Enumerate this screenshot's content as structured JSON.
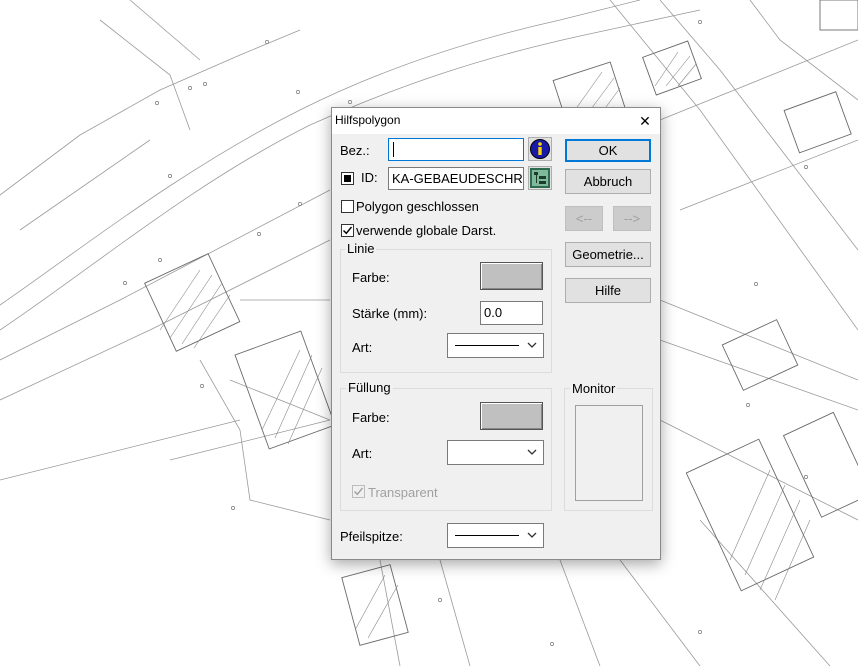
{
  "dialog": {
    "title": "Hilfspolygon",
    "close_glyph": "✕",
    "bez_label": "Bez.:",
    "bez_value": "",
    "id_label": "ID:",
    "id_value": "KA-GEBAEUDESCHR",
    "polygon_closed_label": "Polygon geschlossen",
    "polygon_closed_checked": false,
    "global_display_label": "verwende globale Darst.",
    "global_display_checked": true,
    "buttons": {
      "ok": "OK",
      "cancel": "Abbruch",
      "prev": "<--",
      "next": "-->",
      "geometry": "Geometrie...",
      "help": "Hilfe"
    },
    "line_group": {
      "title": "Linie",
      "color_label": "Farbe:",
      "width_label": "Stärke (mm):",
      "width_value": "0.0",
      "style_label": "Art:"
    },
    "fill_group": {
      "title": "Füllung",
      "color_label": "Farbe:",
      "style_label": "Art:",
      "transparent_label": "Transparent",
      "transparent_checked": true
    },
    "monitor_label": "Monitor",
    "arrow_label": "Pfeilspitze:",
    "swatch_color": "#c0c0c0",
    "accent_color": "#0078d7",
    "icons": [
      "info-icon",
      "tree-select-icon",
      "chevron-down-icon",
      "checkmark-icon",
      "close-icon"
    ]
  }
}
